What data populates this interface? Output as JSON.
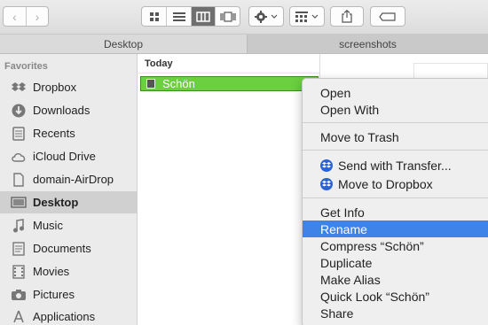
{
  "toolbar": {
    "back_icon": "‹",
    "forward_icon": "›",
    "view_modes": [
      "icon-view",
      "list-view",
      "column-view",
      "cover-flow-view"
    ],
    "active_view": "column-view"
  },
  "tabs": [
    {
      "label": "Desktop",
      "active": true
    },
    {
      "label": "screenshots",
      "active": false
    }
  ],
  "sidebar": {
    "heading": "Favorites",
    "items": [
      {
        "label": "Dropbox",
        "icon": "dropbox-icon"
      },
      {
        "label": "Downloads",
        "icon": "downloads-icon"
      },
      {
        "label": "Recents",
        "icon": "recents-icon"
      },
      {
        "label": "iCloud Drive",
        "icon": "cloud-icon"
      },
      {
        "label": "domain-AirDrop",
        "icon": "document-icon"
      },
      {
        "label": "Desktop",
        "icon": "desktop-icon",
        "active": true
      },
      {
        "label": "Music",
        "icon": "music-icon"
      },
      {
        "label": "Documents",
        "icon": "documents-icon"
      },
      {
        "label": "Movies",
        "icon": "movies-icon"
      },
      {
        "label": "Pictures",
        "icon": "camera-icon"
      },
      {
        "label": "Applications",
        "icon": "applications-icon"
      }
    ]
  },
  "column": {
    "header": "Today",
    "selected_file": "Schön"
  },
  "context_menu": {
    "items": [
      {
        "label": "Open"
      },
      {
        "label": "Open With"
      },
      {
        "label": "Move to Trash"
      },
      {
        "label": "Send with Transfer..."
      },
      {
        "label": "Move to Dropbox"
      },
      {
        "label": "Get Info"
      },
      {
        "label": "Rename",
        "highlighted": true
      },
      {
        "label": "Compress “Schön”"
      },
      {
        "label": "Duplicate"
      },
      {
        "label": "Make Alias"
      },
      {
        "label": "Quick Look “Schön”"
      },
      {
        "label": "Share"
      }
    ]
  },
  "colors": {
    "selection_green": "#6bcf3f",
    "menu_highlight": "#3f82e8",
    "dropbox_blue": "#2a63d8"
  }
}
